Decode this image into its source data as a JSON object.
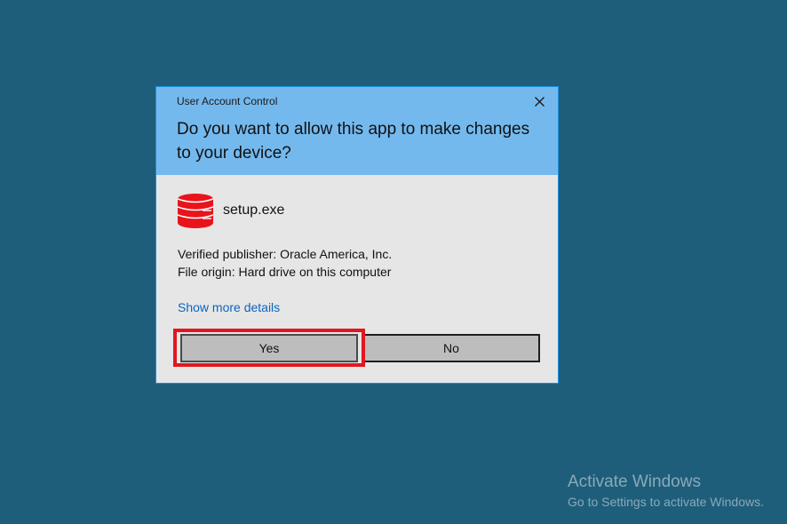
{
  "dialog": {
    "window_title": "User Account Control",
    "question": "Do you want to allow this app to make changes to your device?",
    "app_name": "setup.exe",
    "app_icon": "database-icon",
    "publisher": "Verified publisher: Oracle America, Inc.",
    "origin": "File origin: Hard drive on this computer",
    "details_link": "Show more details",
    "yes_label": "Yes",
    "no_label": "No"
  },
  "watermark": {
    "title": "Activate Windows",
    "subtitle": "Go to Settings to activate Windows."
  },
  "colors": {
    "desktop": "#1e5e7a",
    "header": "#74b9ee",
    "dialog_body": "#e6e6e6",
    "link": "#0a66c2",
    "highlight": "#e3161f",
    "icon_red": "#e8141c"
  }
}
